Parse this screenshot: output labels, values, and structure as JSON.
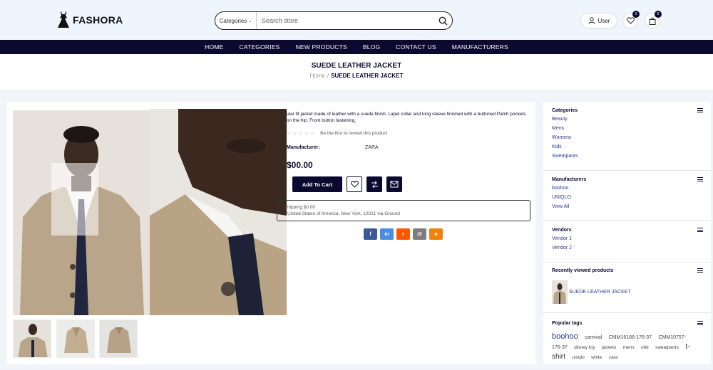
{
  "brand": {
    "name": "FASHORA"
  },
  "search": {
    "category": "Categories",
    "placeholder": "Search store"
  },
  "header": {
    "user_label": "User",
    "wishlist_count": "0",
    "cart_count": "0"
  },
  "nav": [
    "HOME",
    "CATEGORIES",
    "NEW PRODUCTS",
    "BLOG",
    "CONTACT US",
    "MANUFACTURERS"
  ],
  "page": {
    "title": "SUEDE LEATHER JACKET",
    "breadcrumb_home": "Home",
    "breadcrumb_sep": "/",
    "breadcrumb_current": "SUEDE LEATHER JACKET"
  },
  "product": {
    "description": "ular fit jacket made of leather with a suede finish. Lapel collar and long sleeve finished with a buttoned Patch pockets on the hip. Front button fastening.",
    "stars": "☆ ☆ ☆ ☆ ☆",
    "review_prompt": "Be the first to review this product",
    "manufacturer_label": "Manufacturer:",
    "manufacturer_value": "ZARA",
    "price": "$00.00",
    "add_to_cart": "Add To Cart",
    "shipping_line1": "hipping:$0.00",
    "shipping_line2": "United States of America, New York, 10021 via Ground"
  },
  "share": [
    {
      "icon": "facebook-icon",
      "glyph": "f",
      "color": "#3b5998"
    },
    {
      "icon": "messenger-icon",
      "glyph": "m",
      "color": "#4a8de0"
    },
    {
      "icon": "reddit-icon",
      "glyph": "r",
      "color": "#ff5700"
    },
    {
      "icon": "email-icon",
      "glyph": "@",
      "color": "#7d7d7d"
    },
    {
      "icon": "odnoklassniki-icon",
      "glyph": "o",
      "color": "#ee8208"
    }
  ],
  "sidebar": {
    "categories": {
      "title": "Categories",
      "items": [
        "Beauty",
        "Mens",
        "Womens",
        "Kids",
        "Sweatpants"
      ]
    },
    "manufacturers": {
      "title": "Manufacturers",
      "items": [
        "boohoo",
        "UNIQLO",
        "View All"
      ]
    },
    "vendors": {
      "title": "Vendors",
      "items": [
        "Vendor 1",
        "Vendor 2"
      ]
    },
    "recent": {
      "title": "Recently viewed products",
      "item": "SUEDE LEATHER JACKET"
    },
    "tags": {
      "title": "Popular tags",
      "items": [
        {
          "text": "boohoo",
          "size": 11
        },
        {
          "text": "carnival",
          "size": 7
        },
        {
          "text": "CMM16166-176-37",
          "size": 7
        },
        {
          "text": "CMM10757-176-37",
          "size": 7
        },
        {
          "text": "disney toy",
          "size": 6.5
        },
        {
          "text": "jackets",
          "size": 6.5
        },
        {
          "text": "mens",
          "size": 6.5
        },
        {
          "text": "ofel",
          "size": 6.5
        },
        {
          "text": "sweatpants",
          "size": 6.5
        },
        {
          "text": "t-shirt",
          "size": 10
        },
        {
          "text": "uniqlo",
          "size": 6.5
        },
        {
          "text": "white",
          "size": 6.5
        },
        {
          "text": "zara",
          "size": 6.5
        }
      ]
    }
  },
  "colors": {
    "navy": "#0c0930",
    "link": "#2b3a8f",
    "page_bg": "#f1f4f9"
  }
}
